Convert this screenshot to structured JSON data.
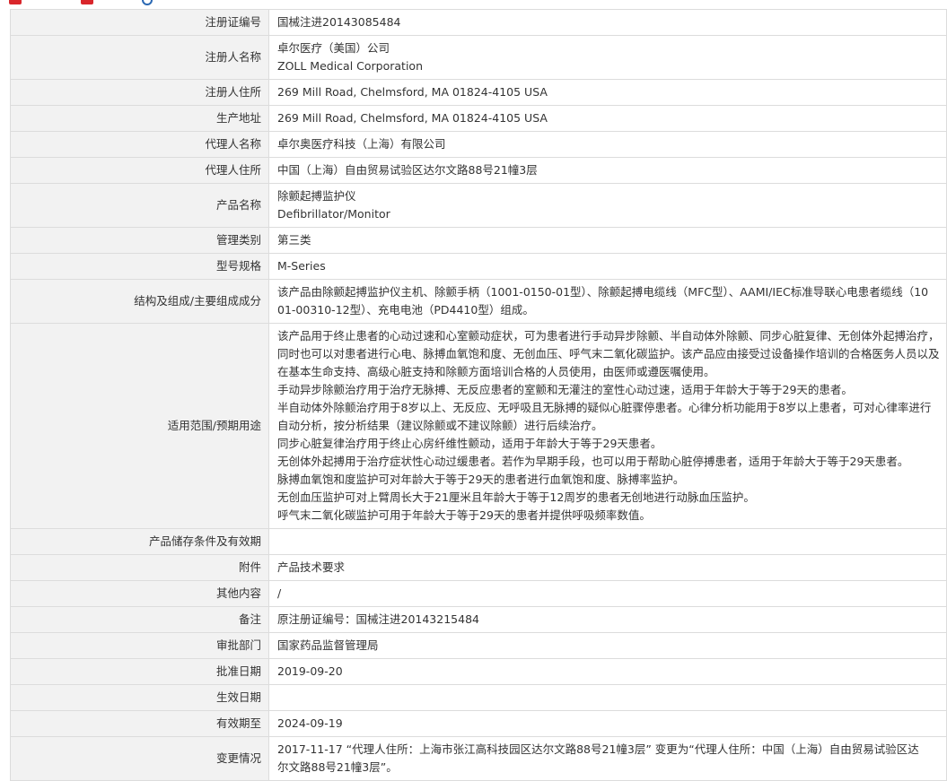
{
  "rows": [
    {
      "label": "注册证编号",
      "lines": [
        "国械注进20143085484"
      ]
    },
    {
      "label": "注册人名称",
      "lines": [
        "卓尔医疗（美国）公司",
        "ZOLL Medical Corporation"
      ]
    },
    {
      "label": "注册人住所",
      "lines": [
        "269 Mill Road, Chelmsford, MA 01824-4105 USA"
      ]
    },
    {
      "label": "生产地址",
      "lines": [
        "269 Mill Road, Chelmsford, MA 01824-4105 USA"
      ]
    },
    {
      "label": "代理人名称",
      "lines": [
        "卓尔奥医疗科技（上海）有限公司"
      ]
    },
    {
      "label": "代理人住所",
      "lines": [
        "中国（上海）自由贸易试验区达尔文路88号21幢3层"
      ]
    },
    {
      "label": "产品名称",
      "lines": [
        "除颤起搏监护仪",
        "Defibrillator/Monitor"
      ]
    },
    {
      "label": "管理类别",
      "lines": [
        "第三类"
      ]
    },
    {
      "label": "型号规格",
      "lines": [
        "M-Series"
      ]
    },
    {
      "label": "结构及组成/主要组成成分",
      "lines": [
        "该产品由除颤起搏监护仪主机、除颤手柄（1001-0150-01型）、除颤起搏电缆线（MFC型）、AAMI/IEC标准导联心电患者缆线（10",
        "01-00310-12型）、充电电池（PD4410型）组成。"
      ]
    },
    {
      "label": "适用范围/预期用途",
      "lines": [
        "该产品用于终止患者的心动过速和心室颤动症状，可为患者进行手动异步除颤、半自动体外除颤、同步心脏复律、无创体外起搏治疗，",
        "同时也可以对患者进行心电、脉搏血氧饱和度、无创血压、呼气末二氧化碳监护。该产品应由接受过设备操作培训的合格医务人员以及",
        "在基本生命支持、高级心脏支持和除颤方面培训合格的人员使用，由医师或遵医嘱使用。",
        "手动异步除颤治疗用于治疗无脉搏、无反应患者的室颤和无灌注的室性心动过速，适用于年龄大于等于29天的患者。",
        "半自动体外除颤治疗用于8岁以上、无反应、无呼吸且无脉搏的疑似心脏骤停患者。心律分析功能用于8岁以上患者，可对心律率进行",
        "自动分析，按分析结果（建议除颤或不建议除颤）进行后续治疗。",
        "同步心脏复律治疗用于终止心房纤维性颤动，适用于年龄大于等于29天患者。",
        "无创体外起搏用于治疗症状性心动过缓患者。若作为早期手段，也可以用于帮助心脏停搏患者，适用于年龄大于等于29天患者。",
        "脉搏血氧饱和度监护可对年龄大于等于29天的患者进行血氧饱和度、脉搏率监护。",
        "无创血压监护可对上臂周长大于21厘米且年龄大于等于12周岁的患者无创地进行动脉血压监护。",
        "呼气末二氧化碳监护可用于年龄大于等于29天的患者并提供呼吸频率数值。"
      ]
    },
    {
      "label": "产品储存条件及有效期",
      "lines": [
        ""
      ]
    },
    {
      "label": "附件",
      "lines": [
        "产品技术要求"
      ]
    },
    {
      "label": "其他内容",
      "lines": [
        "/"
      ]
    },
    {
      "label": "备注",
      "lines": [
        "原注册证编号：国械注进20143215484"
      ]
    },
    {
      "label": "审批部门",
      "lines": [
        "国家药品监督管理局"
      ]
    },
    {
      "label": "批准日期",
      "lines": [
        "2019-09-20"
      ]
    },
    {
      "label": "生效日期",
      "lines": [
        ""
      ]
    },
    {
      "label": "有效期至",
      "lines": [
        "2024-09-19"
      ]
    },
    {
      "label": "变更情况",
      "lines": [
        "2017-11-17 “代理人住所：上海市张江高科技园区达尔文路88号21幢3层” 变更为“代理人住所：中国（上海）自由贸易试验区达",
        "尔文路88号21幢3层”。"
      ]
    }
  ]
}
